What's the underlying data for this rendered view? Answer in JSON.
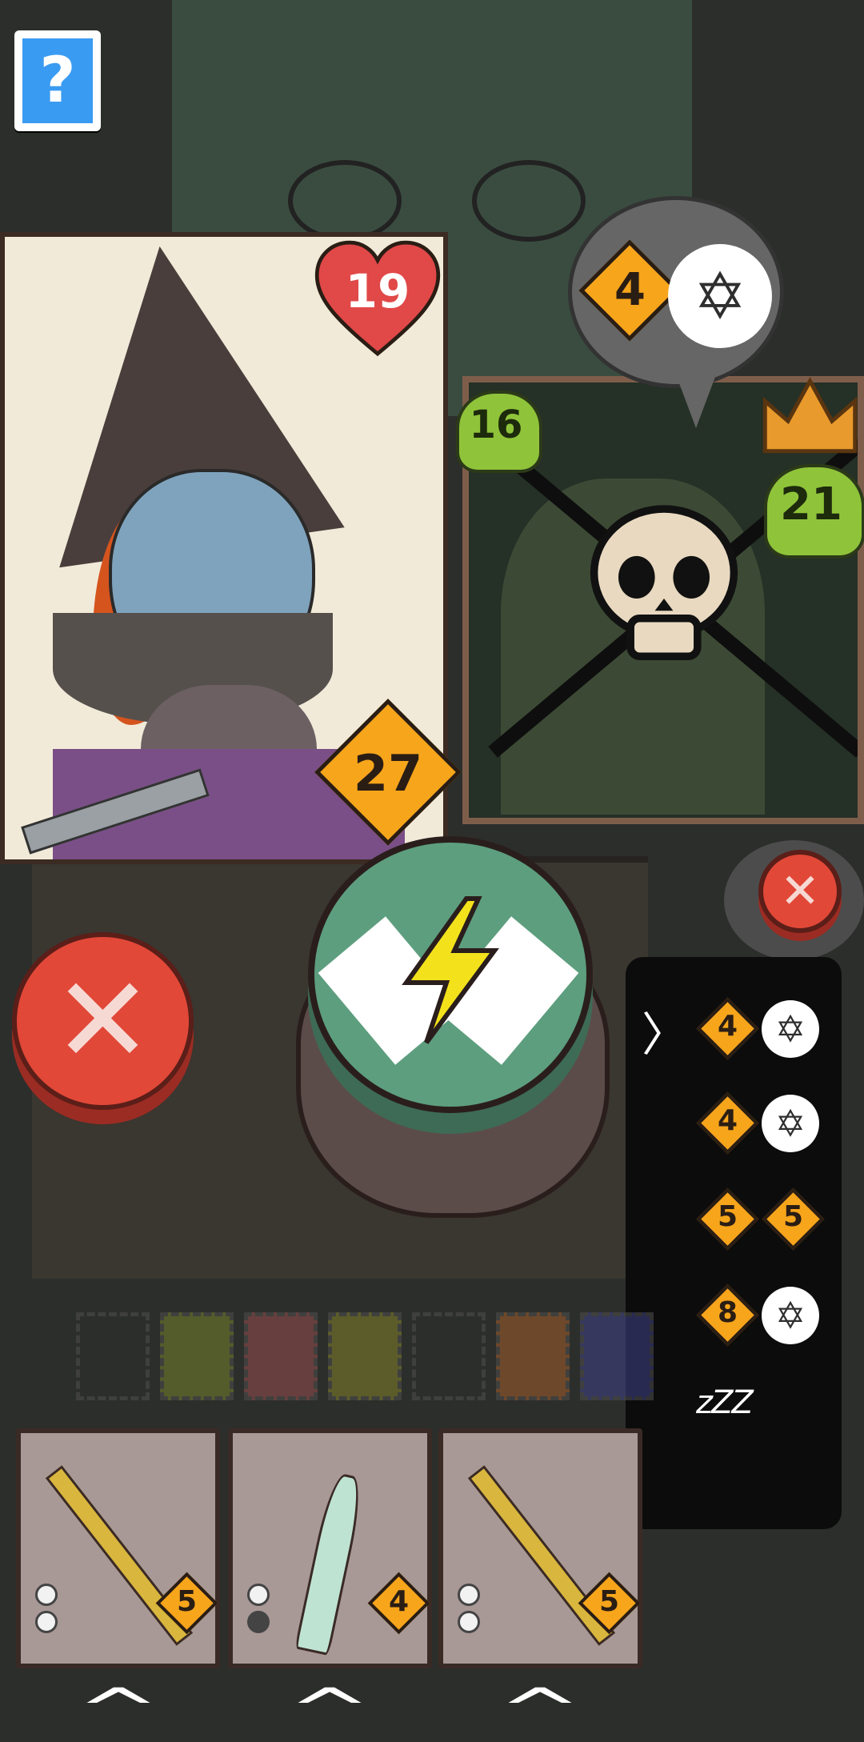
{
  "help": {
    "label": "?"
  },
  "player": {
    "health": "19",
    "armor": "27"
  },
  "enemy": {
    "intent_value": "4",
    "left_skull_value": "16",
    "right_skull_value": "21"
  },
  "pentagram_glyphs": "✡",
  "queue": {
    "rows": [
      {
        "first": "4",
        "second": "pentagram",
        "active": true
      },
      {
        "first": "4",
        "second": "pentagram",
        "active": false
      },
      {
        "first": "5",
        "second": "5",
        "active": false
      },
      {
        "first": "8",
        "second": "pentagram",
        "active": false
      }
    ],
    "sleep": "zZZ",
    "arrow": "〉"
  },
  "buttons": {
    "cancel_big": "✕",
    "cancel_small": "✕"
  },
  "hand": [
    {
      "name": "sai",
      "cost": "5",
      "charges": [
        true,
        true
      ]
    },
    {
      "name": "dagger",
      "cost": "4",
      "charges": [
        true,
        false
      ]
    },
    {
      "name": "sai",
      "cost": "5",
      "charges": [
        true,
        true
      ]
    }
  ],
  "chevron": "^",
  "colors": {
    "diamond": "#f7a51b",
    "heart": "#e14848",
    "skull": "#8fc43a",
    "crown": "#e89a2c",
    "red_button": "#e14838",
    "main_button": "#5d9e7e",
    "bolt": "#f3e21b"
  },
  "icons": [
    "help-icon",
    "heart-icon",
    "diamond-icon",
    "pentagram-icon",
    "skull-icon",
    "crown-icon",
    "close-icon",
    "lightning-icon",
    "chevron-up-icon",
    "sleep-icon"
  ]
}
